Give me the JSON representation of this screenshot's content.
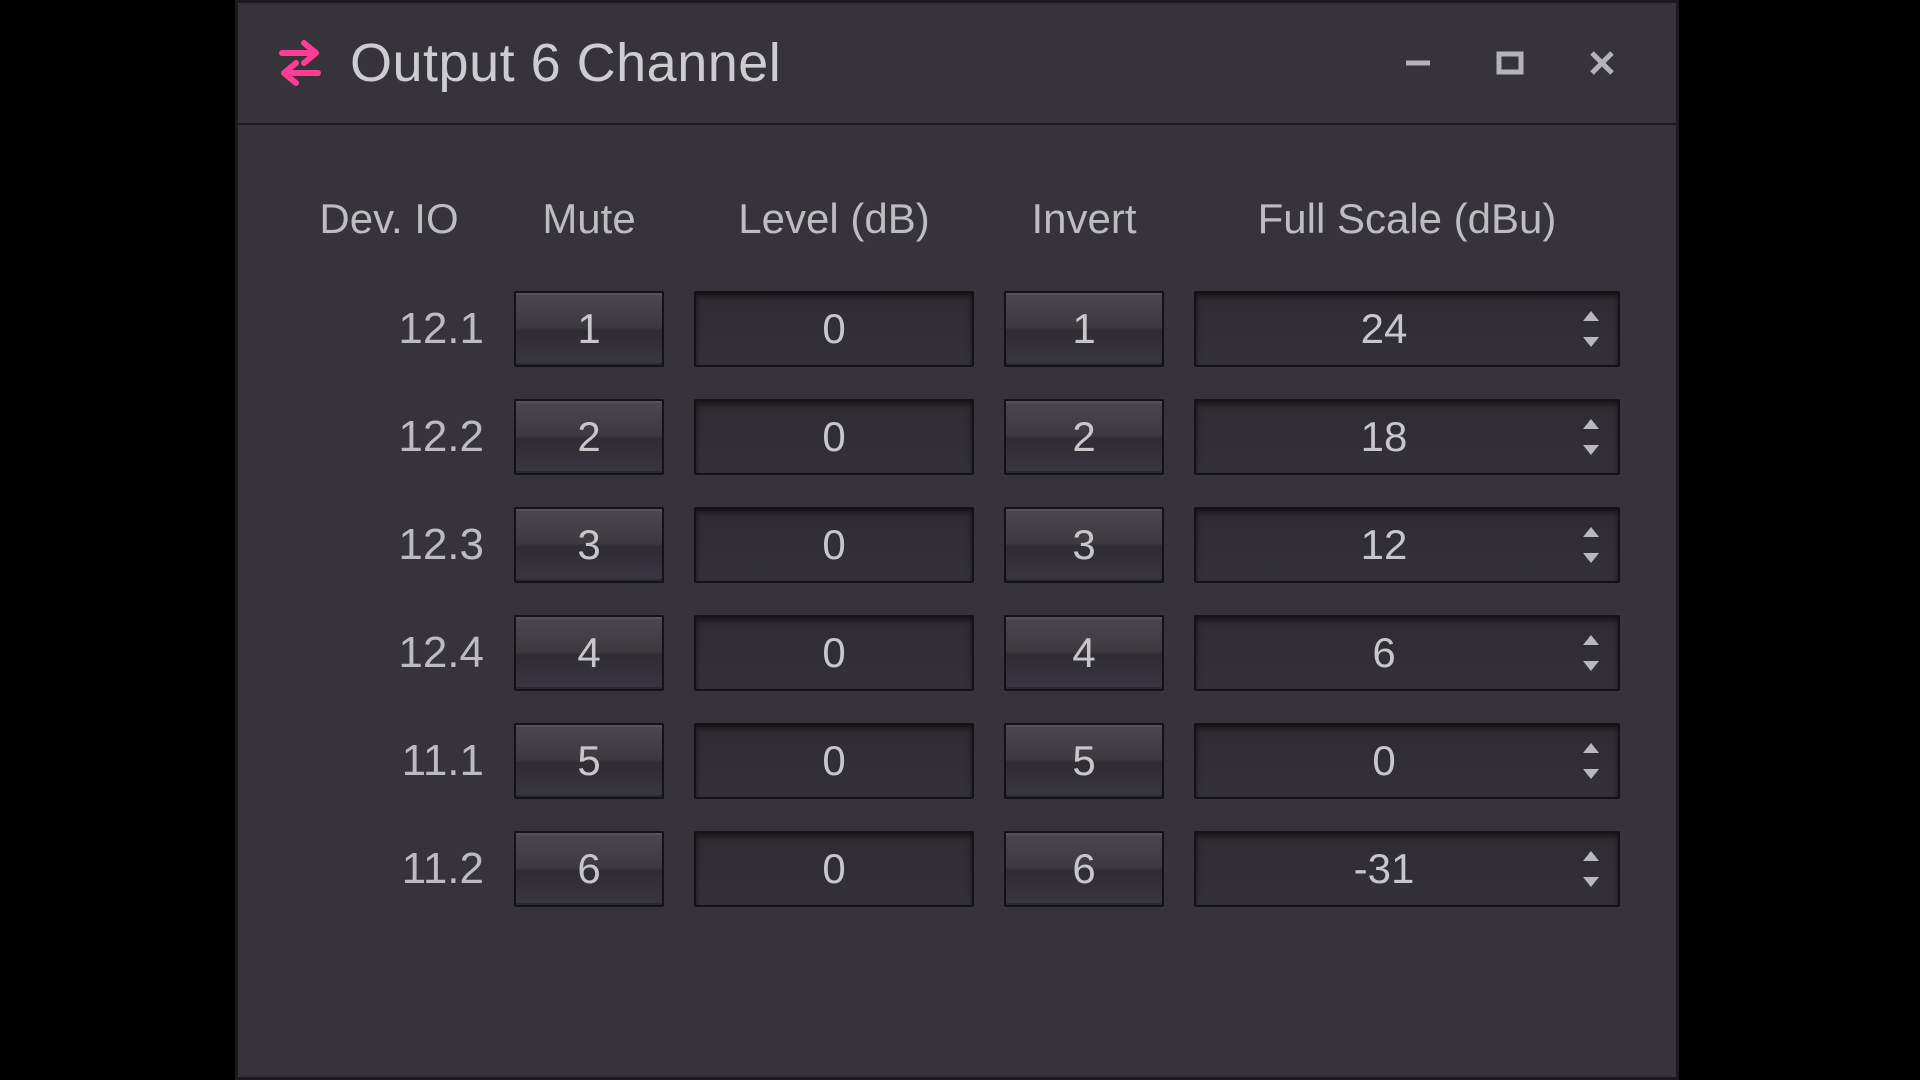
{
  "window": {
    "title": "Output 6 Channel"
  },
  "columns": {
    "devio": "Dev. IO",
    "mute": "Mute",
    "level": "Level (dB)",
    "invert": "Invert",
    "fullscale": "Full Scale (dBu)"
  },
  "rows": [
    {
      "devio": "12.1",
      "mute": "1",
      "level": "0",
      "invert": "1",
      "fullscale": "24"
    },
    {
      "devio": "12.2",
      "mute": "2",
      "level": "0",
      "invert": "2",
      "fullscale": "18"
    },
    {
      "devio": "12.3",
      "mute": "3",
      "level": "0",
      "invert": "3",
      "fullscale": "12"
    },
    {
      "devio": "12.4",
      "mute": "4",
      "level": "0",
      "invert": "4",
      "fullscale": "6"
    },
    {
      "devio": "11.1",
      "mute": "5",
      "level": "0",
      "invert": "5",
      "fullscale": "0"
    },
    {
      "devio": "11.2",
      "mute": "6",
      "level": "0",
      "invert": "6",
      "fullscale": "-31"
    }
  ]
}
